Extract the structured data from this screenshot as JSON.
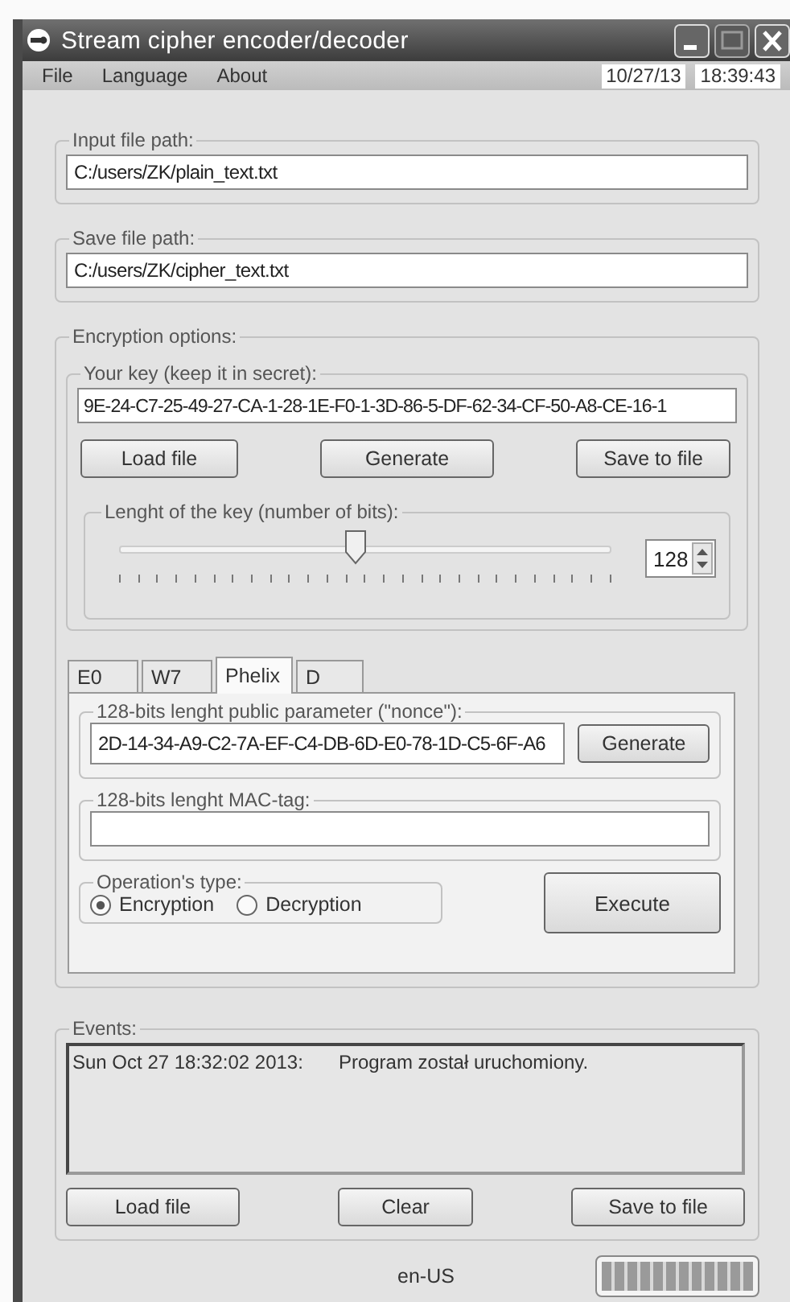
{
  "window": {
    "title": "Stream cipher encoder/decoder"
  },
  "menu": [
    "File",
    "Language",
    "About"
  ],
  "clock": {
    "date": "10/27/13",
    "time": "18:39:43"
  },
  "input_file": {
    "label": "Input file path:",
    "value": "C:/users/ZK/plain_text.txt"
  },
  "save_file": {
    "label": "Save file path:",
    "value": "C:/users/ZK/cipher_text.txt"
  },
  "encryption": {
    "label": "Encryption options:",
    "key": {
      "label": "Your key (keep it in secret):",
      "value": "9E-24-C7-25-49-27-CA-1-28-1E-F0-1-3D-86-5-DF-62-34-CF-50-A8-CE-16-1",
      "buttons": [
        "Load file",
        "Generate",
        "Save to file"
      ]
    },
    "key_length": {
      "label": "Lenght of the key (number of bits):",
      "level": 0.48,
      "value": "128"
    }
  },
  "tabs": [
    {
      "label": "E0",
      "selected": false
    },
    {
      "label": "W7",
      "selected": false
    },
    {
      "label": "Phelix",
      "selected": true
    },
    {
      "label": "D",
      "selected": false
    }
  ],
  "phelix": {
    "nonce": {
      "label": "128-bits lenght public parameter (\"nonce\"):",
      "value": "2D-14-34-A9-C2-7A-EF-C4-DB-6D-E0-78-1D-C5-6F-A6",
      "button": "Generate"
    },
    "mac": {
      "label": "128-bits lenght MAC-tag:"
    },
    "operation": {
      "label": "Operation's type:",
      "options": [
        {
          "label": "Encryption",
          "selected": true
        },
        {
          "label": "Decryption",
          "selected": false
        }
      ]
    },
    "execute": "Execute"
  },
  "events": {
    "label": "Events:",
    "entries": [
      {
        "time": "Sun Oct 27 18:32:02 2013:",
        "message": "Program został uruchomiony."
      }
    ],
    "buttons": [
      "Load file",
      "Clear",
      "Save to file"
    ]
  },
  "status": {
    "locale": "en-US",
    "progress": {
      "level": 1
    }
  }
}
